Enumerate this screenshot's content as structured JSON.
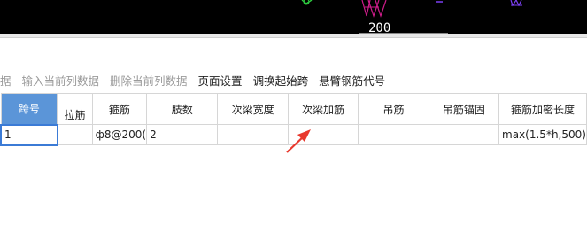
{
  "cad_view": {
    "scale_text": "200"
  },
  "toolbar": {
    "items": [
      {
        "label": "据",
        "enabled": false
      },
      {
        "label": "输入当前列数据",
        "enabled": false
      },
      {
        "label": "删除当前列数据",
        "enabled": false
      },
      {
        "label": "页面设置",
        "enabled": true
      },
      {
        "label": "调换起始跨",
        "enabled": true
      },
      {
        "label": "悬臂钢筋代号",
        "enabled": true
      }
    ]
  },
  "table": {
    "headers": [
      "跨号",
      "拉筋",
      "箍筋",
      "肢数",
      "次梁宽度",
      "次梁加筋",
      "吊筋",
      "吊筋锚固",
      "箍筋加密长度"
    ],
    "rows": [
      [
        "1",
        "",
        "ф8@200(",
        "2",
        "",
        "",
        "",
        "",
        "max(1.5*h,500)"
      ]
    ]
  },
  "colors": {
    "selected_header_bg": "#5b95d8",
    "arrow": "#e8392e",
    "cad_background": "#000000"
  }
}
